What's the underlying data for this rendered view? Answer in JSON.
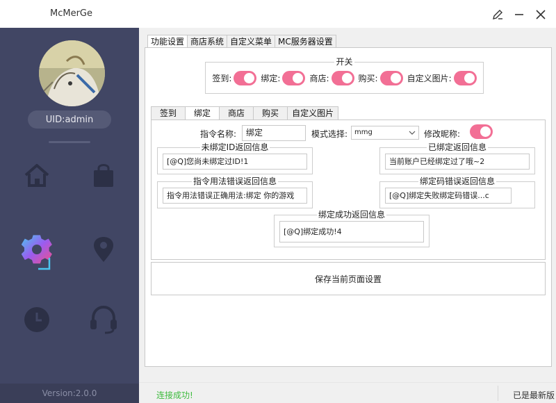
{
  "app": {
    "title": "McMerGe"
  },
  "sidebar": {
    "uid": "UID:admin",
    "version": "Version:2.0.0",
    "nav_icons": [
      "home-icon",
      "shopping-bag-icon",
      "settings-gear-icon",
      "location-pin-icon",
      "clock-icon",
      "headset-icon"
    ],
    "active_item": "settings-gear-icon"
  },
  "main_tabs": [
    "功能设置",
    "商店系统",
    "自定义菜单",
    "MC服务器设置"
  ],
  "main_tabs_active": 0,
  "switches": {
    "title": "开关",
    "items": [
      {
        "label": "签到:",
        "on": true
      },
      {
        "label": "绑定:",
        "on": true
      },
      {
        "label": "商店:",
        "on": true
      },
      {
        "label": "购买:",
        "on": true
      },
      {
        "label": "自定义图片:",
        "on": true
      }
    ]
  },
  "sub_tabs": [
    "签到",
    "绑定",
    "商店",
    "购买",
    "自定义图片"
  ],
  "sub_tabs_active": 1,
  "bind": {
    "command_label": "指令名称:",
    "command_value": "绑定",
    "mode_label": "模式选择:",
    "mode_value": "mmg",
    "nickname_label": "修改昵称:",
    "nickname_on": true,
    "unbound_title": "未绑定ID返回信息",
    "unbound_value": "[@Q]您尚未绑定过ID!1",
    "bound_title": "已绑定返回信息",
    "bound_value": "当前账户已经绑定过了哦~2",
    "usage_error_title": "指令用法错误返回信息",
    "usage_error_value": "指令用法错误正确用法:绑定 你的游戏",
    "code_error_title": "绑定码错误返回信息",
    "code_error_value": "[@Q]绑定失败绑定码错误...c",
    "success_title": "绑定成功返回信息",
    "success_value": "[@Q]绑定成功!4"
  },
  "save_button": "保存当前页面设置",
  "status": {
    "message": "连接成功!",
    "update": "已是最新版"
  },
  "colors": {
    "sidebar": "#414664",
    "toggle_on": "#f26f95",
    "status_ok": "#3dbb3d"
  }
}
